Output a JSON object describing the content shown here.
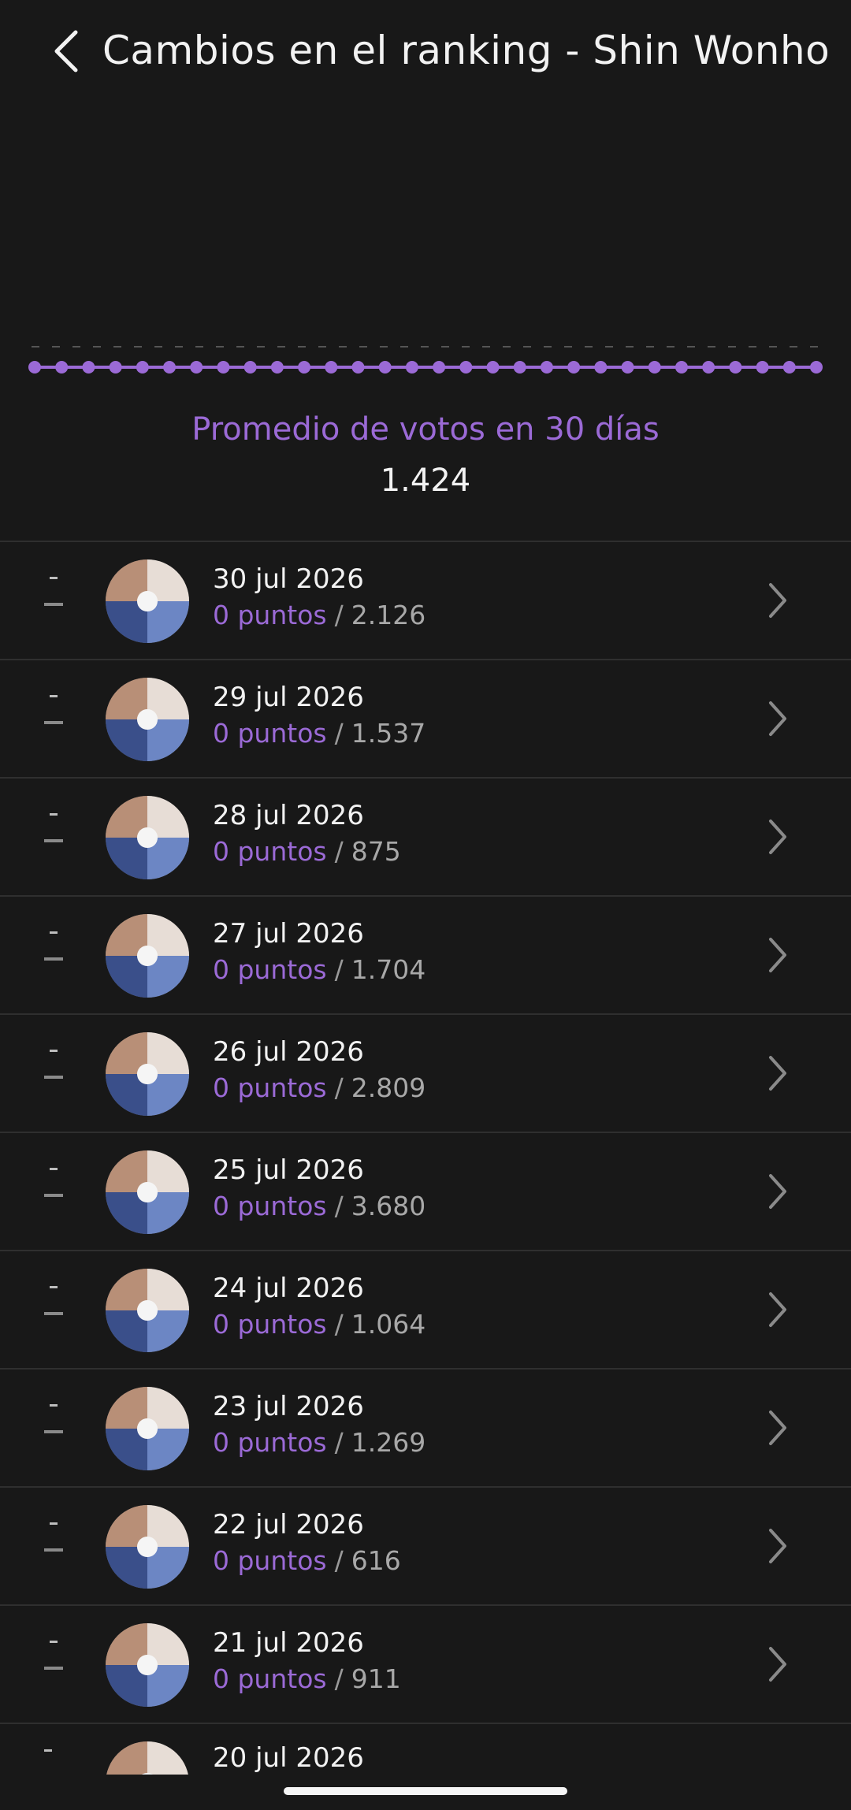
{
  "header": {
    "title": "Cambios en el ranking - Shin Wonho",
    "back_icon": "chevron-left-icon"
  },
  "chart": {
    "point_count": 30,
    "line_color": "#9b6ad6",
    "grid_color": "#555555"
  },
  "summary": {
    "label": "Promedio de votos en 30 días",
    "value": "1.424"
  },
  "list": {
    "items": [
      {
        "change": "-",
        "date": "30 jul 2026",
        "points": "0 puntos",
        "sep": "/",
        "votes": "2.126"
      },
      {
        "change": "-",
        "date": "29 jul 2026",
        "points": "0 puntos",
        "sep": "/",
        "votes": "1.537"
      },
      {
        "change": "-",
        "date": "28 jul 2026",
        "points": "0 puntos",
        "sep": "/",
        "votes": "875"
      },
      {
        "change": "-",
        "date": "27 jul 2026",
        "points": "0 puntos",
        "sep": "/",
        "votes": "1.704"
      },
      {
        "change": "-",
        "date": "26 jul 2026",
        "points": "0 puntos",
        "sep": "/",
        "votes": "2.809"
      },
      {
        "change": "-",
        "date": "25 jul 2026",
        "points": "0 puntos",
        "sep": "/",
        "votes": "3.680"
      },
      {
        "change": "-",
        "date": "24 jul 2026",
        "points": "0 puntos",
        "sep": "/",
        "votes": "1.064"
      },
      {
        "change": "-",
        "date": "23 jul 2026",
        "points": "0 puntos",
        "sep": "/",
        "votes": "1.269"
      },
      {
        "change": "-",
        "date": "22 jul 2026",
        "points": "0 puntos",
        "sep": "/",
        "votes": "616"
      },
      {
        "change": "-",
        "date": "21 jul 2026",
        "points": "0 puntos",
        "sep": "/",
        "votes": "911"
      }
    ],
    "partial_item": {
      "date": "20 jul 2026"
    }
  },
  "colors": {
    "background": "#181818",
    "accent": "#9b6ad6",
    "text": "#f2f2f2",
    "muted": "#a8a8a8",
    "divider": "#2f2f2f"
  }
}
